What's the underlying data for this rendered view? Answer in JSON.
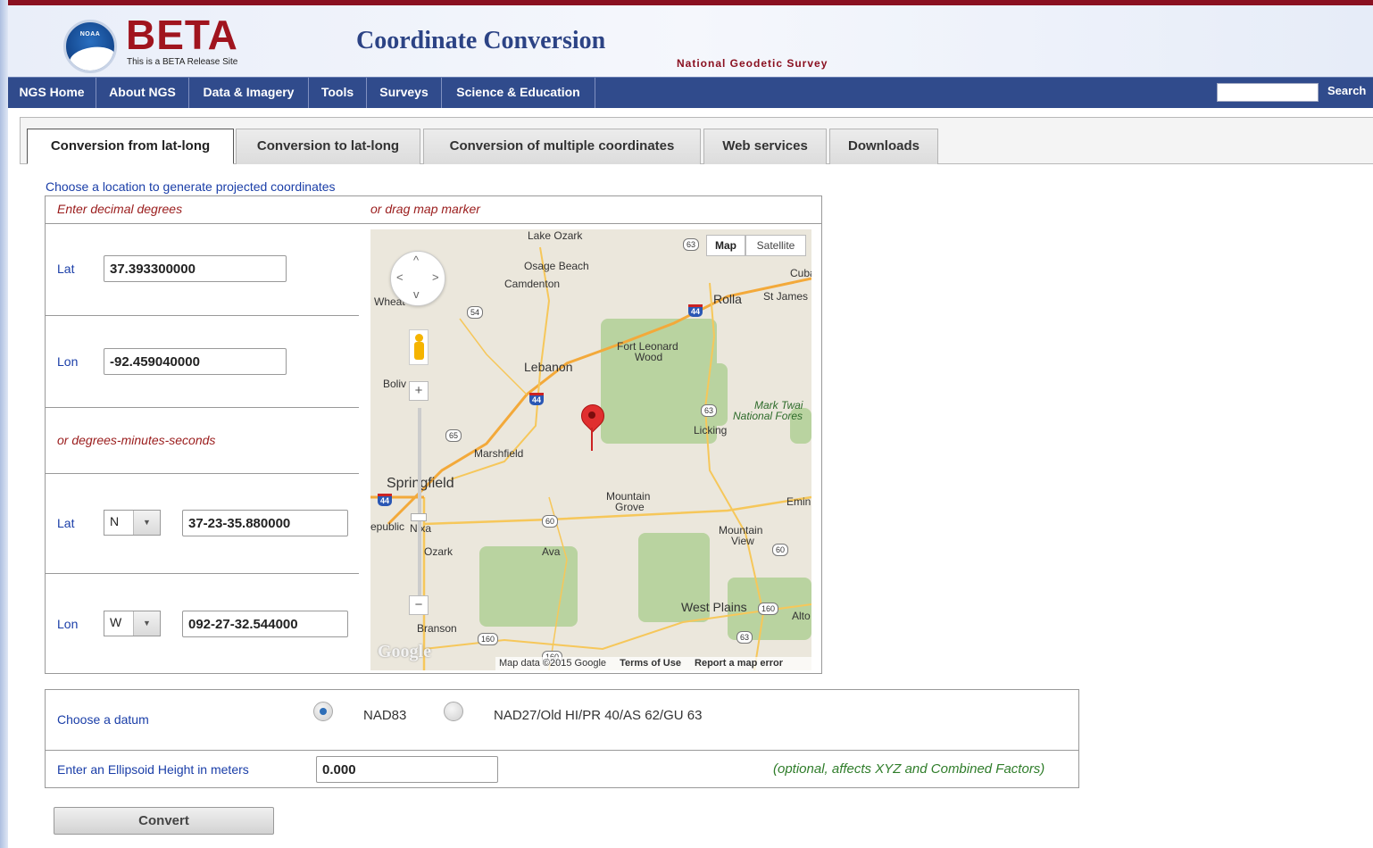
{
  "header": {
    "beta": "BETA",
    "beta_sub": "This is a BETA Release Site",
    "title": "Coordinate Conversion",
    "org": "National Geodetic Survey",
    "logo_text": "NOAA"
  },
  "nav": {
    "items": [
      "NGS Home",
      "About NGS",
      "Data & Imagery",
      "Tools",
      "Surveys",
      "Science & Education"
    ],
    "search_label": "Search",
    "search_value": ""
  },
  "tabs": [
    {
      "label": "Conversion from lat-long",
      "active": true
    },
    {
      "label": "Conversion to lat-long",
      "active": false
    },
    {
      "label": "Conversion of multiple coordinates",
      "active": false
    },
    {
      "label": "Web services",
      "active": false
    },
    {
      "label": "Downloads",
      "active": false
    }
  ],
  "form": {
    "choose_location": "Choose a location to generate projected coordinates",
    "enter_decimal": "Enter decimal degrees",
    "or_drag": "or drag map marker",
    "lat_label": "Lat",
    "lon_label": "Lon",
    "lat_decimal": "37.393300000",
    "lon_decimal": "-92.459040000",
    "or_dms": "or degrees-minutes-seconds",
    "lat_dir": "N",
    "lon_dir": "W",
    "lat_dms": "37-23-35.880000",
    "lon_dms": "092-27-32.544000",
    "datum_label": "Choose a datum",
    "datum_options": [
      "NAD83",
      "NAD27/Old HI/PR 40/AS 62/GU 63"
    ],
    "datum_selected": "NAD83",
    "ellipsoid_label": "Enter an Ellipsoid Height in meters",
    "ellipsoid_value": "0.000",
    "ellipsoid_note": "(optional, affects XYZ and Combined Factors)",
    "convert_label": "Convert"
  },
  "map": {
    "type_map": "Map",
    "type_satellite": "Satellite",
    "attribution": "Map data ©2015 Google",
    "terms": "Terms of Use",
    "report": "Report a map error",
    "google": "Google",
    "places": [
      "Lake Ozark",
      "Osage Beach",
      "Camdenton",
      "Cuba",
      "Rolla",
      "St James",
      "Wheat",
      "Fort Leonard",
      "Wood",
      "Lebanon",
      "Boliv",
      "Mark Twai",
      "National Fores",
      "Licking",
      "Marshfield",
      "Springfield",
      "Mountain",
      "Grove",
      "Emin",
      "epublic",
      "Nixa",
      "Ozark",
      "Ava",
      "Mountain",
      "View",
      "West Plains",
      "Alto",
      "Branson"
    ],
    "highways": [
      "63",
      "54",
      "44",
      "44",
      "63",
      "65",
      "44",
      "60",
      "60",
      "160",
      "160",
      "63",
      "160"
    ],
    "colors": {
      "land": "#ebe7dc",
      "forest": "#b9d3a0",
      "marker": "#e02f2f"
    }
  },
  "colors": {
    "accent": "#304b8c",
    "header_border": "#8a1020",
    "link": "#1a3ea8",
    "note": "#2f7d2a"
  }
}
